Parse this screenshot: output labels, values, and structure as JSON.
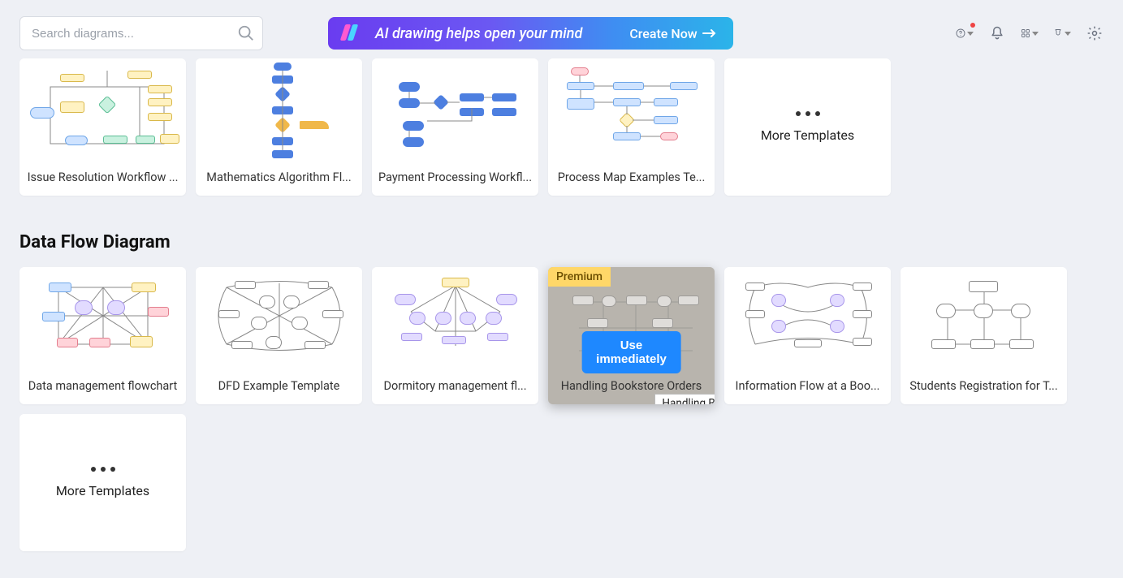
{
  "search": {
    "placeholder": "Search diagrams..."
  },
  "banner": {
    "text": "AI drawing helps open your mind",
    "cta": "Create Now"
  },
  "row1": {
    "cards": [
      {
        "label": "Issue Resolution Workflow ..."
      },
      {
        "label": "Mathematics Algorithm Fl..."
      },
      {
        "label": "Payment Processing Workfl..."
      },
      {
        "label": "Process Map Examples Te..."
      }
    ],
    "more": "More Templates"
  },
  "section2": {
    "title": "Data Flow Diagram",
    "cards": [
      {
        "label": "Data management flowchart"
      },
      {
        "label": "DFD Example Template"
      },
      {
        "label": "Dormitory management fl..."
      },
      {
        "label": "Handling Bookstore Orders",
        "premium": "Premium",
        "use": "Use immediately",
        "tooltip": "Handling Bookstore Orders"
      },
      {
        "label": "Information Flow at a Boo..."
      },
      {
        "label": "Students Registration for T..."
      }
    ],
    "more": "More Templates"
  }
}
